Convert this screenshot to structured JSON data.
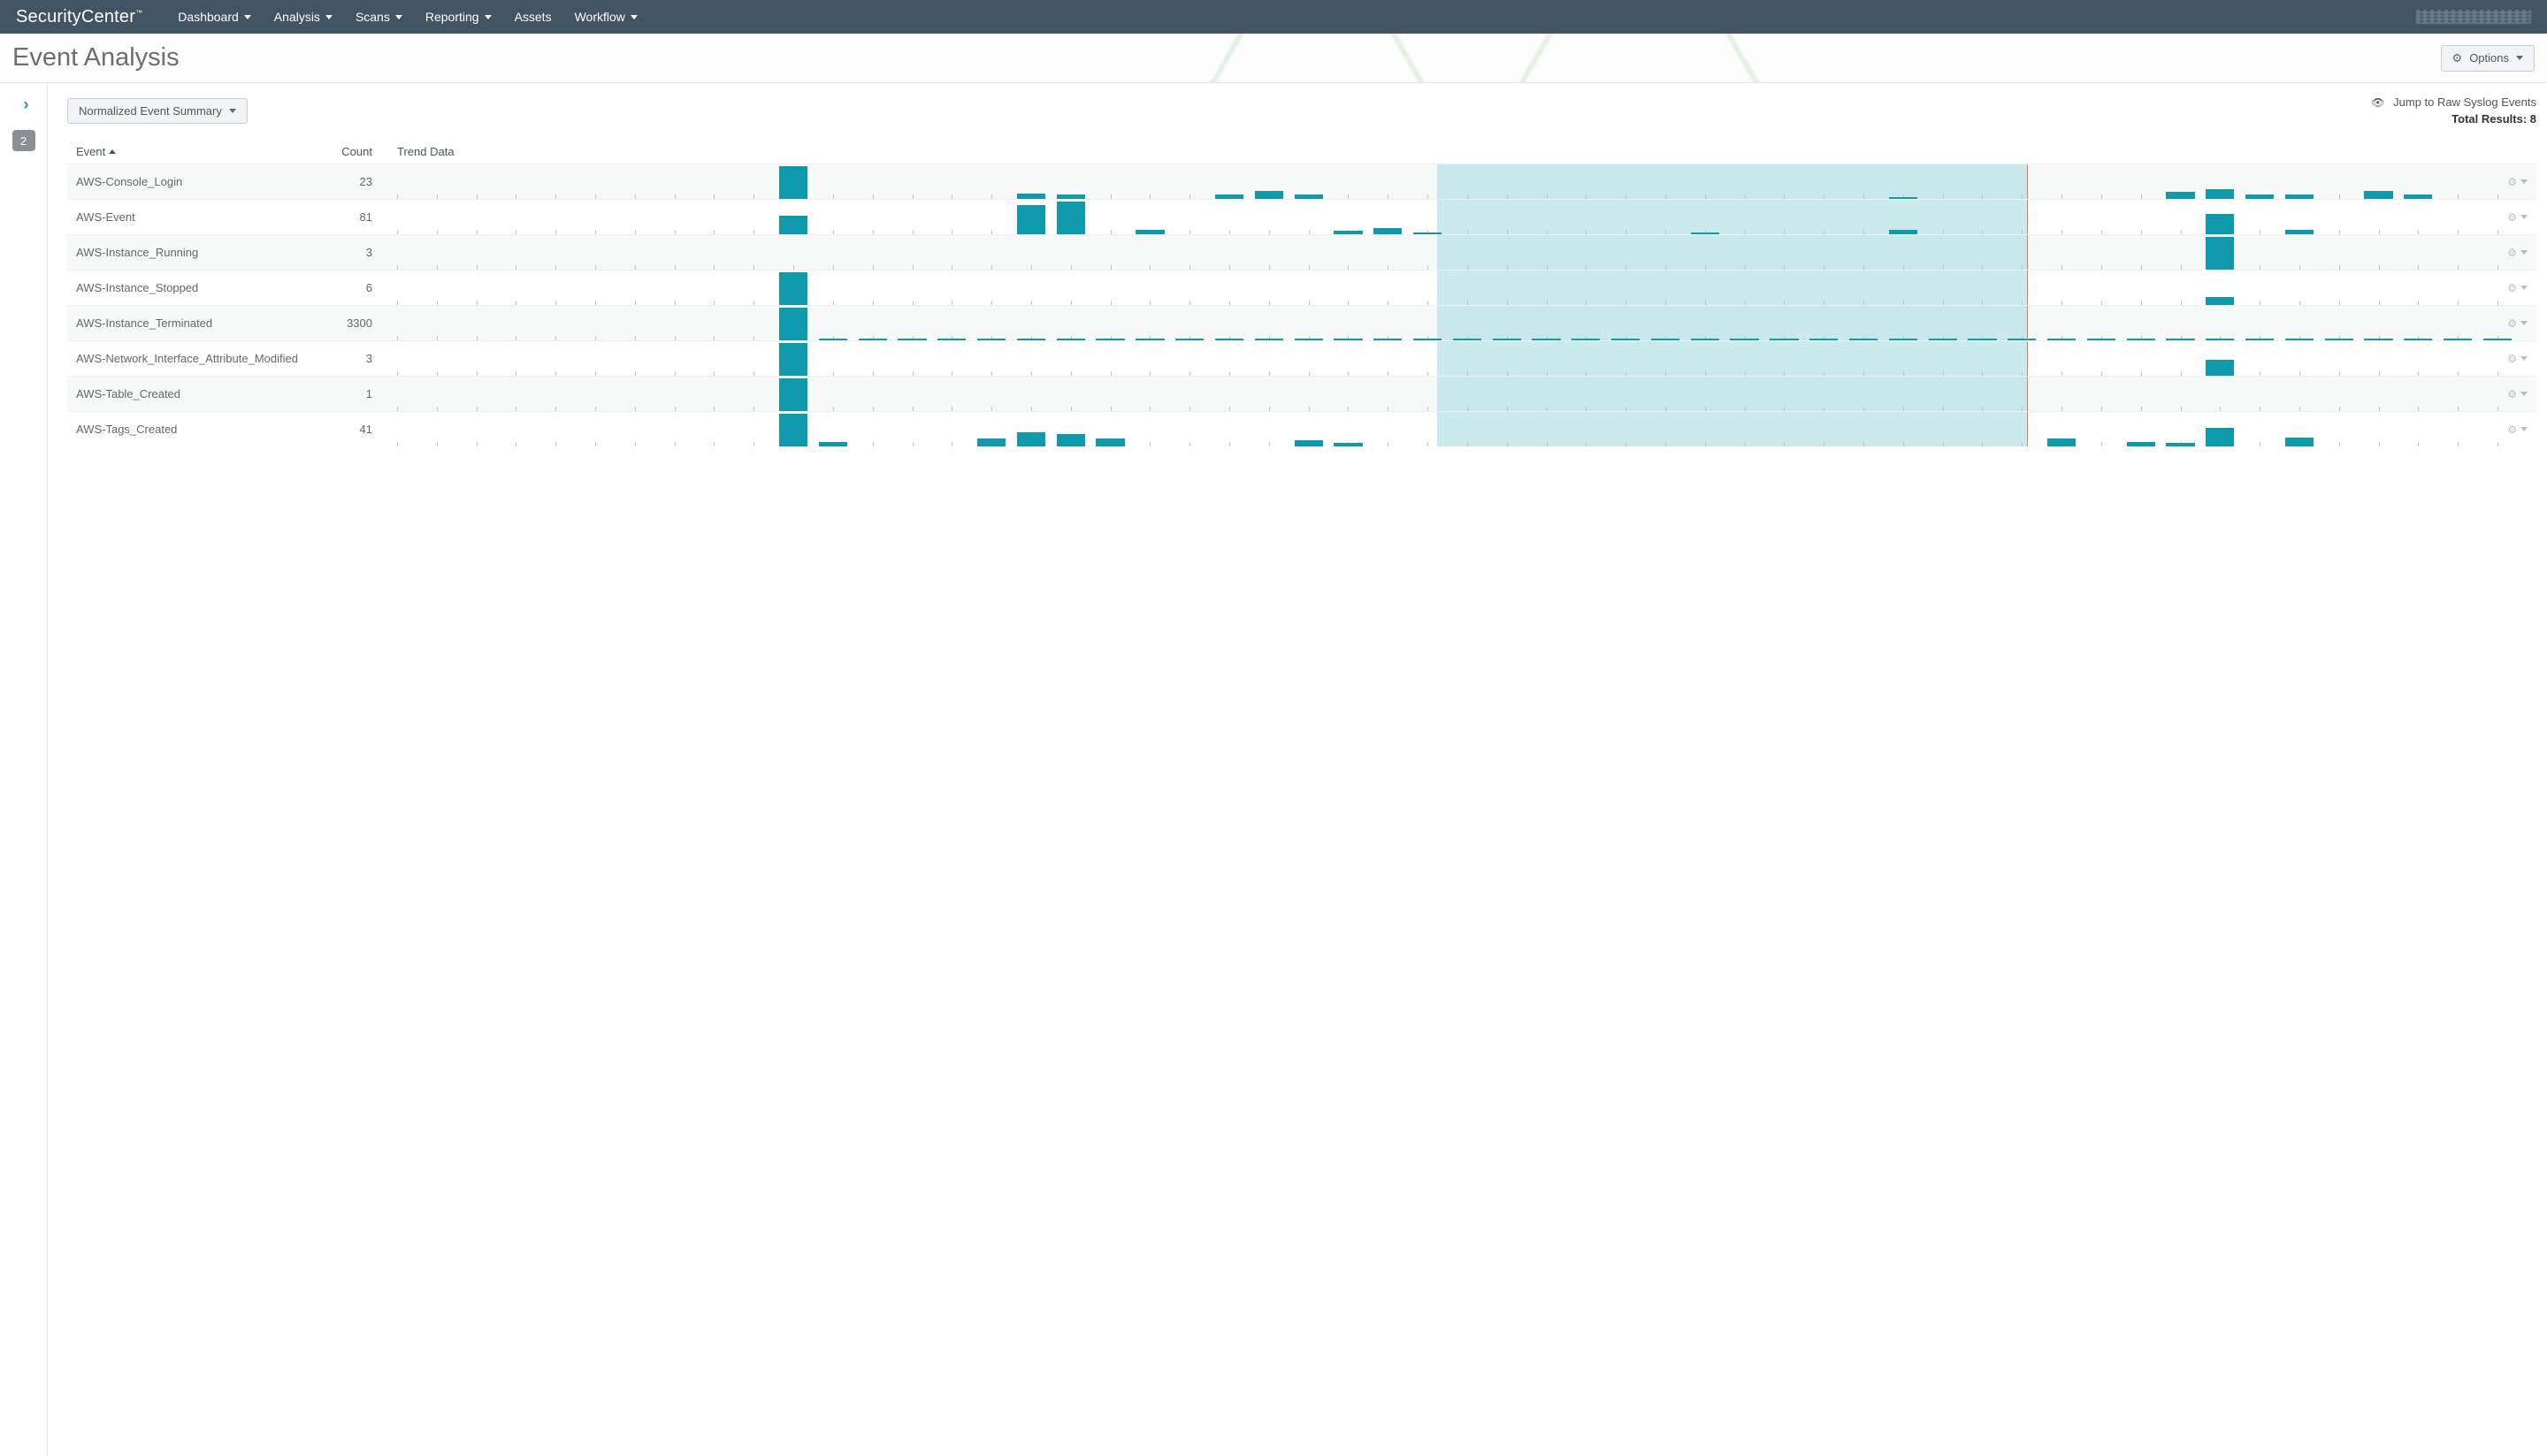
{
  "brand": {
    "a": "Security",
    "b": "Center"
  },
  "nav": [
    {
      "label": "Dashboard",
      "dd": true
    },
    {
      "label": "Analysis",
      "dd": true
    },
    {
      "label": "Scans",
      "dd": true
    },
    {
      "label": "Reporting",
      "dd": true
    },
    {
      "label": "Assets",
      "dd": false
    },
    {
      "label": "Workflow",
      "dd": true
    }
  ],
  "page": {
    "title": "Event Analysis",
    "options_label": "Options"
  },
  "left_rail": {
    "filter_count": "2"
  },
  "toolbar": {
    "view_selector": "Normalized Event Summary",
    "jump_link": "Jump to Raw Syslog Events",
    "total_label": "Total Results: 8"
  },
  "columns": {
    "event": "Event",
    "count": "Count",
    "trend": "Trend Data"
  },
  "spark_config": {
    "ticks": 54,
    "selection_pct": [
      49.5,
      77.6
    ],
    "now_pct": 77.6
  },
  "chart_data": {
    "type": "bar",
    "title": "Normalized Event Summary",
    "xlabel": "",
    "ylabel": "",
    "note": "Each row is a sparkline of 54 time buckets. Values are relative heights per row (0–1). Exact counts are not labeled on screen; bucket heights are visual estimates.",
    "series": [
      {
        "name": "AWS-Console_Login",
        "total": 23
      },
      {
        "name": "AWS-Event",
        "total": 81
      },
      {
        "name": "AWS-Instance_Running",
        "total": 3
      },
      {
        "name": "AWS-Instance_Stopped",
        "total": 6
      },
      {
        "name": "AWS-Instance_Terminated",
        "total": 3300
      },
      {
        "name": "AWS-Network_Interface_Attribute_Modified",
        "total": 3
      },
      {
        "name": "AWS-Table_Created",
        "total": 1
      },
      {
        "name": "AWS-Tags_Created",
        "total": 41
      }
    ]
  },
  "rows": [
    {
      "event": "AWS-Console_Login",
      "count": "23",
      "bars": [
        [
          10,
          0.95
        ],
        [
          16,
          0.15
        ],
        [
          17,
          0.12
        ],
        [
          21,
          0.12
        ],
        [
          22,
          0.22
        ],
        [
          23,
          0.12
        ],
        [
          38,
          0.05
        ],
        [
          45,
          0.2
        ],
        [
          46,
          0.28
        ],
        [
          47,
          0.14
        ],
        [
          48,
          0.12
        ],
        [
          50,
          0.22
        ],
        [
          51,
          0.12
        ]
      ]
    },
    {
      "event": "AWS-Event",
      "count": "81",
      "bars": [
        [
          10,
          0.55
        ],
        [
          16,
          0.85
        ],
        [
          17,
          0.95
        ],
        [
          19,
          0.12
        ],
        [
          24,
          0.1
        ],
        [
          25,
          0.18
        ],
        [
          26,
          0.05
        ],
        [
          33,
          0.06
        ],
        [
          38,
          0.14
        ],
        [
          46,
          0.6
        ],
        [
          48,
          0.14
        ]
      ]
    },
    {
      "event": "AWS-Instance_Running",
      "count": "3",
      "bars": [
        [
          46,
          0.95
        ]
      ]
    },
    {
      "event": "AWS-Instance_Stopped",
      "count": "6",
      "bars": [
        [
          10,
          0.95
        ],
        [
          46,
          0.22
        ]
      ]
    },
    {
      "event": "AWS-Instance_Terminated",
      "count": "3300",
      "bars": [
        [
          10,
          0.95
        ],
        [
          11,
          0.06
        ],
        [
          12,
          0.06
        ],
        [
          13,
          0.06
        ],
        [
          14,
          0.06
        ],
        [
          15,
          0.06
        ],
        [
          16,
          0.06
        ],
        [
          17,
          0.06
        ],
        [
          18,
          0.06
        ],
        [
          19,
          0.06
        ],
        [
          20,
          0.06
        ],
        [
          21,
          0.06
        ],
        [
          22,
          0.06
        ],
        [
          23,
          0.06
        ],
        [
          24,
          0.06
        ],
        [
          25,
          0.06
        ],
        [
          26,
          0.06
        ],
        [
          27,
          0.06
        ],
        [
          28,
          0.06
        ],
        [
          29,
          0.06
        ],
        [
          30,
          0.06
        ],
        [
          31,
          0.06
        ],
        [
          32,
          0.06
        ],
        [
          33,
          0.06
        ],
        [
          34,
          0.06
        ],
        [
          35,
          0.06
        ],
        [
          36,
          0.06
        ],
        [
          37,
          0.06
        ],
        [
          38,
          0.06
        ],
        [
          39,
          0.06
        ],
        [
          40,
          0.06
        ],
        [
          41,
          0.06
        ],
        [
          42,
          0.06
        ],
        [
          43,
          0.06
        ],
        [
          44,
          0.06
        ],
        [
          45,
          0.06
        ],
        [
          46,
          0.06
        ],
        [
          47,
          0.06
        ],
        [
          48,
          0.06
        ],
        [
          49,
          0.06
        ],
        [
          50,
          0.06
        ],
        [
          51,
          0.06
        ],
        [
          52,
          0.06
        ],
        [
          53,
          0.06
        ]
      ]
    },
    {
      "event": "AWS-Network_Interface_Attribute_Modified",
      "count": "3",
      "bars": [
        [
          10,
          0.95
        ],
        [
          46,
          0.45
        ]
      ]
    },
    {
      "event": "AWS-Table_Created",
      "count": "1",
      "bars": [
        [
          10,
          0.95
        ]
      ]
    },
    {
      "event": "AWS-Tags_Created",
      "count": "41",
      "bars": [
        [
          10,
          0.95
        ],
        [
          11,
          0.12
        ],
        [
          15,
          0.22
        ],
        [
          16,
          0.4
        ],
        [
          17,
          0.35
        ],
        [
          18,
          0.22
        ],
        [
          23,
          0.18
        ],
        [
          24,
          0.1
        ],
        [
          42,
          0.22
        ],
        [
          44,
          0.12
        ],
        [
          45,
          0.1
        ],
        [
          46,
          0.55
        ],
        [
          48,
          0.25
        ]
      ]
    }
  ]
}
